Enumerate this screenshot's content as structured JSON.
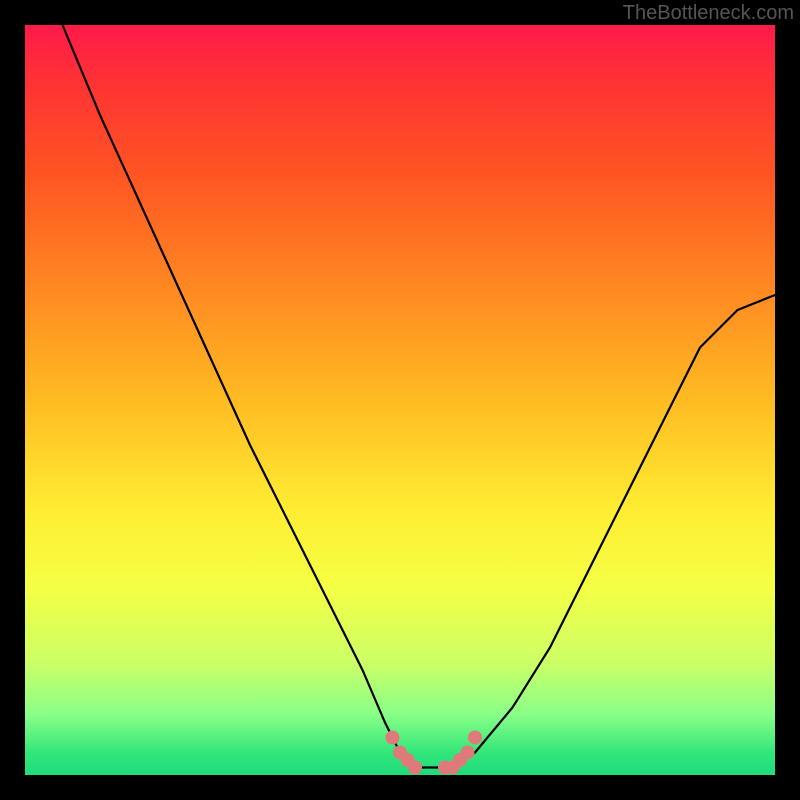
{
  "watermark": "TheBottleneck.com",
  "chart_data": {
    "type": "line",
    "title": "",
    "xlabel": "",
    "ylabel": "",
    "xlim": [
      0,
      100
    ],
    "ylim": [
      0,
      100
    ],
    "series": [
      {
        "name": "curve",
        "x": [
          5,
          10,
          15,
          20,
          25,
          30,
          35,
          40,
          45,
          48,
          50,
          52,
          53,
          55,
          57,
          60,
          65,
          70,
          75,
          80,
          85,
          90,
          95,
          100
        ],
        "y": [
          100,
          88,
          77,
          66,
          55,
          44,
          34,
          24,
          14,
          7,
          3,
          1,
          1,
          1,
          1,
          3,
          9,
          17,
          27,
          37,
          47,
          57,
          62,
          64
        ]
      }
    ],
    "markers": [
      {
        "x": 49,
        "y": 5
      },
      {
        "x": 50,
        "y": 3
      },
      {
        "x": 51,
        "y": 2
      },
      {
        "x": 52,
        "y": 1
      },
      {
        "x": 56,
        "y": 1
      },
      {
        "x": 57,
        "y": 1
      },
      {
        "x": 58,
        "y": 2
      },
      {
        "x": 59,
        "y": 3
      },
      {
        "x": 60,
        "y": 5
      }
    ],
    "marker_color": "#e07a7a",
    "curve_color": "#000000"
  }
}
